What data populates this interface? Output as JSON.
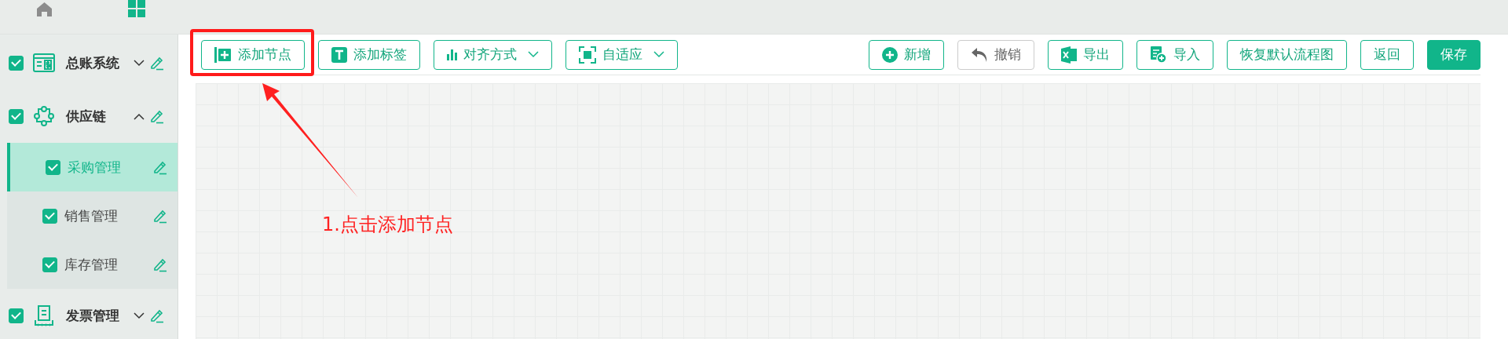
{
  "sidebar": {
    "items": [
      {
        "label": "总账系统",
        "checked": true,
        "expanded": false,
        "selected": false
      },
      {
        "label": "供应链",
        "checked": true,
        "expanded": true,
        "selected": false,
        "children": [
          {
            "label": "采购管理",
            "checked": true,
            "selected": true
          },
          {
            "label": "销售管理",
            "checked": true,
            "selected": false
          },
          {
            "label": "库存管理",
            "checked": true,
            "selected": false
          }
        ]
      },
      {
        "label": "发票管理",
        "checked": true,
        "expanded": false,
        "selected": false
      }
    ]
  },
  "toolbar": {
    "left": [
      {
        "label": "添加节点",
        "kind": "outline",
        "dropdown": false
      },
      {
        "label": "添加标签",
        "kind": "outline",
        "dropdown": false
      },
      {
        "label": "对齐方式",
        "kind": "outline",
        "dropdown": true
      },
      {
        "label": "自适应",
        "kind": "outline",
        "dropdown": true
      }
    ],
    "right": [
      {
        "label": "新增",
        "kind": "outline",
        "disabled": false
      },
      {
        "label": "撤销",
        "kind": "outline",
        "disabled": true
      },
      {
        "label": "导出",
        "kind": "outline",
        "disabled": false
      },
      {
        "label": "导入",
        "kind": "outline",
        "disabled": false
      },
      {
        "label": "恢复默认流程图",
        "kind": "outline",
        "disabled": false
      },
      {
        "label": "返回",
        "kind": "outline",
        "disabled": false
      },
      {
        "label": "保存",
        "kind": "primary",
        "disabled": false
      }
    ]
  },
  "annotation": {
    "text": "1.点击添加节点"
  }
}
